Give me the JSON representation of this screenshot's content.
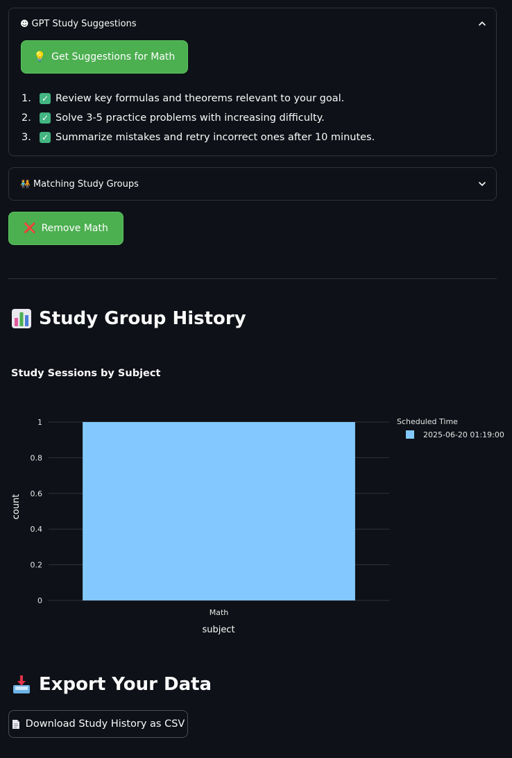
{
  "suggestions_expander": {
    "icon": "☻",
    "title": "GPT Study Suggestions",
    "button_icon": "💡",
    "button_label": "Get Suggestions for Math",
    "items": [
      "Review key formulas and theorems relevant to your goal.",
      "Solve 3-5 practice problems with increasing difficulty.",
      "Summarize mistakes and retry incorrect ones after 10 minutes."
    ],
    "numbers": [
      "1.",
      "2.",
      "3."
    ]
  },
  "groups_expander": {
    "icon": "🧑‍🤝‍🧑",
    "title": "Matching Study Groups"
  },
  "remove_button": {
    "icon": "❌",
    "label": "Remove Math"
  },
  "history_section": {
    "heading": "Study Group History"
  },
  "chart_data": {
    "type": "bar",
    "title": "Study Sessions by Subject",
    "categories": [
      "Math"
    ],
    "series": [
      {
        "name": "2025-06-20 01:19:00",
        "values": [
          1
        ],
        "color": "#83c9ff"
      }
    ],
    "xlabel": "subject",
    "ylabel": "count",
    "ylim": [
      0,
      1
    ],
    "yticks": [
      "0",
      "0.2",
      "0.4",
      "0.6",
      "0.8",
      "1"
    ],
    "legend_title": "Scheduled Time",
    "legend_position": "top-right",
    "grid": true
  },
  "export_section": {
    "heading": "Export Your Data",
    "download_label": "Download Study History as CSV"
  },
  "colors": {
    "background": "#0e1117",
    "button_green": "#4caf50",
    "bar": "#83c9ff",
    "border": "#31333f"
  }
}
